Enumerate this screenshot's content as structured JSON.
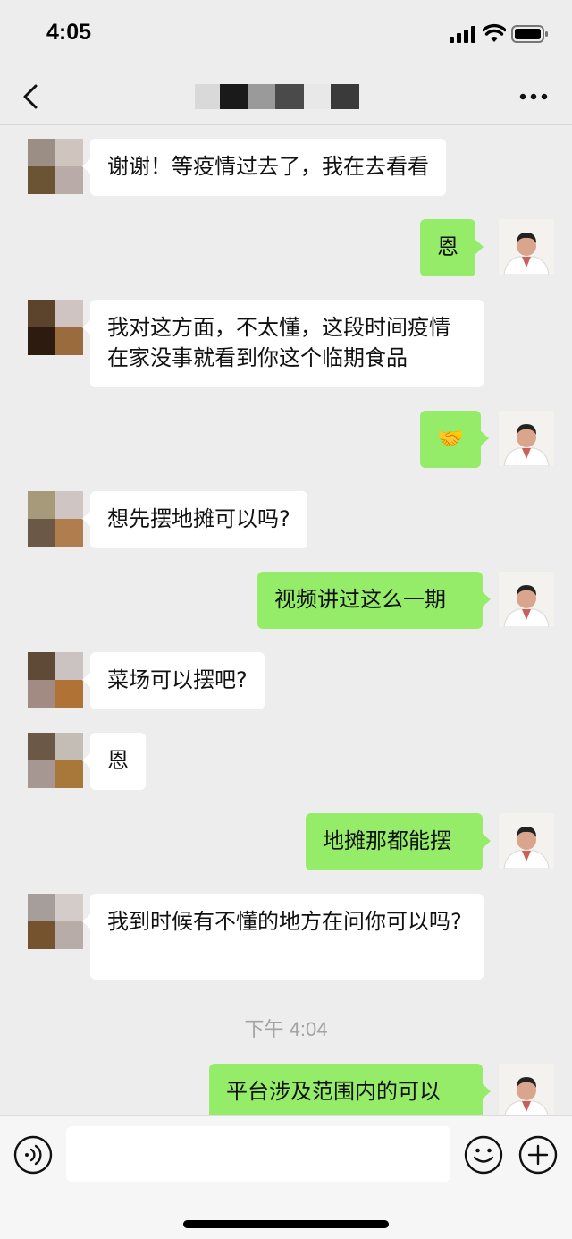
{
  "status_bar": {
    "time": "4:05"
  },
  "chat": {
    "messages": [
      {
        "from": "other",
        "text": "谢谢！等疫情过去了，我在去看看"
      },
      {
        "from": "me",
        "text": "恩"
      },
      {
        "from": "other",
        "text": "我对这方面，不太懂，这段时间疫情在家没事就看到你这个临期食品"
      },
      {
        "from": "me",
        "text": "🤝"
      },
      {
        "from": "other",
        "text": "想先摆地摊可以吗?"
      },
      {
        "from": "me",
        "text": "视频讲过这么一期"
      },
      {
        "from": "other",
        "text": "菜场可以摆吧?"
      },
      {
        "from": "other",
        "text": "恩"
      },
      {
        "from": "me",
        "text": "地摊那都能摆"
      },
      {
        "from": "other",
        "text": "我到时候有不懂的地方在问你可以吗?"
      },
      {
        "from": "me",
        "text": "平台涉及范围内的可以"
      }
    ],
    "timestamp": "下午 4:04"
  },
  "colors": {
    "background": "#ededed",
    "incoming_bubble": "#ffffff",
    "outgoing_bubble": "#95ec69",
    "timestamp_text": "#a3a3a3"
  },
  "icons": {
    "back": "chevron-left-icon",
    "more": "more-dots-icon",
    "voice": "voice-icon",
    "emoji": "emoji-icon",
    "plus": "plus-icon"
  }
}
